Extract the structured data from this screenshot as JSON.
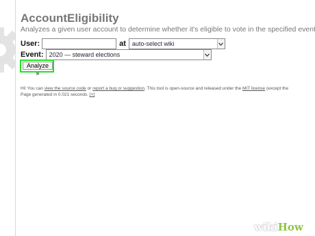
{
  "header": {
    "title": "AccountEligibility",
    "description": "Analyzes a given user account to determine whether it's eligible to vote in the specified event."
  },
  "form": {
    "user_label": "User:",
    "user_value": "",
    "at_label": "at",
    "wiki_selected": "auto-select wiki",
    "event_label": "Event:",
    "event_selected": "2020 — steward elections",
    "analyze_label": "Analyze »",
    "highlight_color": "#20e020"
  },
  "footer": {
    "part1": "Hi! You can ",
    "view_source": "view the source code",
    "part2": " or ",
    "report_bug": "report a bug or suggestion",
    "part3": ". This tool is open-source and released under the ",
    "license": "MIT license",
    "part4": " (except the",
    "generated": "Page generated in 0.021 seconds. ",
    "toggle": "[+]"
  },
  "watermark": {
    "wiki": "wiki",
    "how": "How"
  },
  "icons": {
    "gear": "gear-icon",
    "dropdown": "chevron-down-icon"
  }
}
